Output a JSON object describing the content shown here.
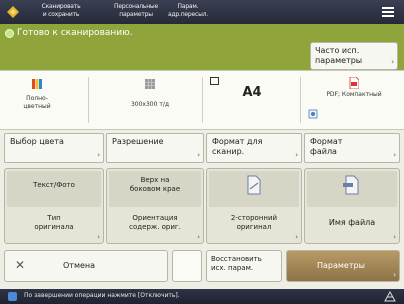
{
  "header": {
    "tabs": [
      {
        "line1": "Сканировать",
        "line2": "и сохранить"
      },
      {
        "line1": "Персональные",
        "line2": "параметры"
      },
      {
        "line1": "Парам.",
        "line2": "адр.пересыл."
      }
    ]
  },
  "status": {
    "text": "Готово к сканированию.",
    "favorites_line1": "Часто исп.",
    "favorites_line2": "параметры"
  },
  "summary": {
    "color_line1": "Полно-",
    "color_line2": "цветный",
    "resolution": "300x300 т/д",
    "size": "A4",
    "format": "PDF; Компактный"
  },
  "buttons": {
    "color": "Выбор цвета",
    "resolution": "Разрешение",
    "scan_size_line1": "Формат для",
    "scan_size_line2": "сканир.",
    "file_format_line1": "Формат",
    "file_format_line2": "файла"
  },
  "functions": {
    "type_value": "Текст/Фото",
    "type_label_line1": "Тип",
    "type_label_line2": "оригинала",
    "orient_value_line1": "Верх на",
    "orient_value_line2": "боковом крае",
    "orient_label_line1": "Ориентация",
    "orient_label_line2": "содерж. ориг.",
    "duplex_line1": "2-сторонний",
    "duplex_line2": "оригинал",
    "filename": "Имя файла"
  },
  "bottom": {
    "cancel": "Отмена",
    "restore_line1": "Восстановить",
    "restore_line2": "исх. парам.",
    "options": "Параметры"
  },
  "footer": {
    "text": "По завершении операции нажмите [Отключить]."
  },
  "colors": {
    "status_green": "#8fa53c",
    "header_dark": "#262a38",
    "options_button": "#9a7f4f"
  }
}
